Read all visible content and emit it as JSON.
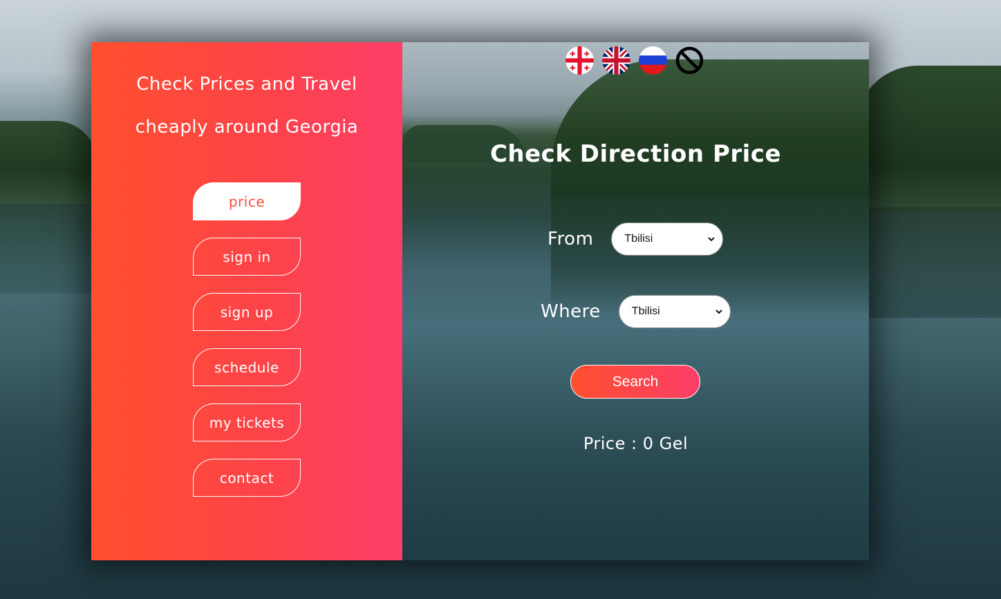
{
  "sidebar": {
    "tagline_line1": "Check Prices and Travel",
    "tagline_line2": "cheaply around Georgia",
    "nav": [
      {
        "label": "price",
        "active": true
      },
      {
        "label": "sign in"
      },
      {
        "label": "sign up"
      },
      {
        "label": "schedule"
      },
      {
        "label": "my tickets"
      },
      {
        "label": "contact"
      }
    ]
  },
  "languages": [
    {
      "icon": "georgia-flag-icon",
      "code": "ka"
    },
    {
      "icon": "uk-flag-icon",
      "code": "en"
    },
    {
      "icon": "russia-flag-icon",
      "code": "ru"
    },
    {
      "icon": "prohibited-icon",
      "code": "none"
    }
  ],
  "main": {
    "heading": "Check Direction Price",
    "from_label": "From",
    "from_value": "Tbilisi",
    "where_label": "Where",
    "where_value": "Tbilisi",
    "search_label": "Search",
    "price_text": "Price : 0 Gel"
  },
  "colors": {
    "accent_start": "#ff4f2e",
    "accent_end": "#fc3e68",
    "white": "#ffffff"
  }
}
